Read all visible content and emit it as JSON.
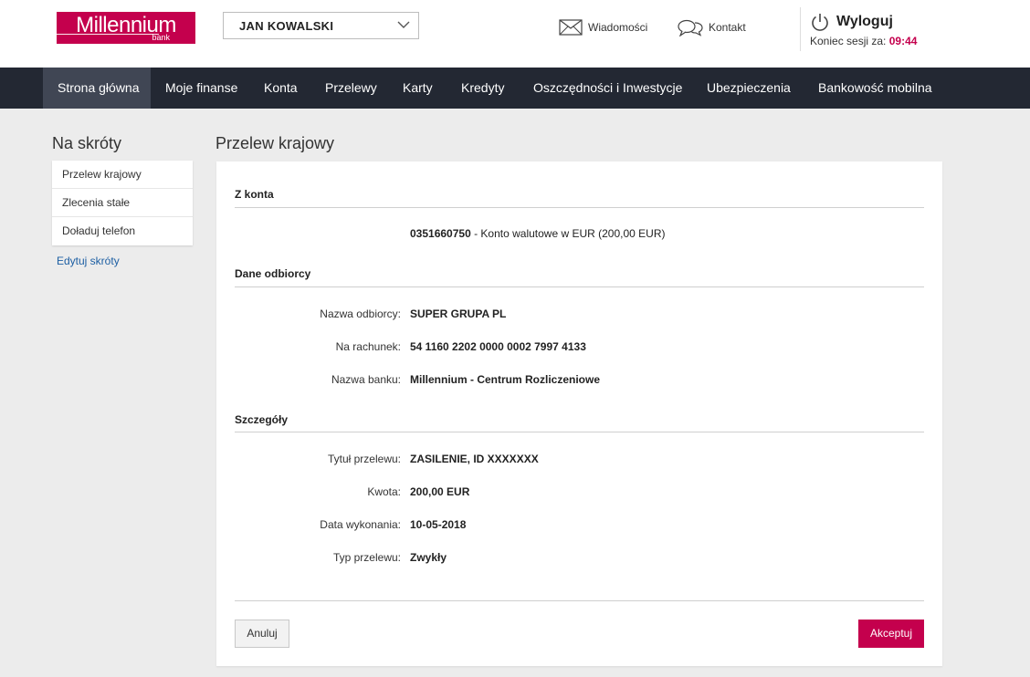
{
  "header": {
    "logo_brand": "Millennium",
    "logo_sub": "bank",
    "user_name": "JAN KOWALSKI",
    "messages_label": "Wiadomości",
    "contact_label": "Kontakt",
    "logout_label": "Wyloguj",
    "session_label": "Koniec sesji za:",
    "session_time": "09:44"
  },
  "nav": {
    "items": [
      {
        "label": "Strona główna",
        "active": true
      },
      {
        "label": "Moje finanse"
      },
      {
        "label": "Konta"
      },
      {
        "label": "Przelewy"
      },
      {
        "label": "Karty"
      },
      {
        "label": "Kredyty"
      },
      {
        "label": "Oszczędności i Inwestycje"
      },
      {
        "label": "Ubezpieczenia"
      },
      {
        "label": "Bankowość mobilna"
      }
    ]
  },
  "sidebar": {
    "title": "Na skróty",
    "items": [
      "Przelew krajowy",
      "Zlecenia stałe",
      "Doładuj telefon"
    ],
    "edit_label": "Edytuj skróty"
  },
  "main": {
    "title": "Przelew krajowy",
    "from_section": "Z konta",
    "from_account_number": "0351660750",
    "from_account_desc": " - Konto walutowe w EUR (200,00 EUR)",
    "recipient_section": "Dane odbiorcy",
    "recipient_rows": [
      {
        "label": "Nazwa odbiorcy:",
        "value": "SUPER GRUPA PL"
      },
      {
        "label": "Na rachunek:",
        "value": "54 1160 2202 0000 0002 7997 4133"
      },
      {
        "label": "Nazwa banku:",
        "value": "Millennium - Centrum Rozliczeniowe"
      }
    ],
    "details_section": "Szczegóły",
    "details_rows": [
      {
        "label": "Tytuł przelewu:",
        "value": "ZASILENIE, ID XXXXXXX"
      },
      {
        "label": "Kwota:",
        "value": "200,00 EUR"
      },
      {
        "label": "Data wykonania:",
        "value": "10-05-2018"
      },
      {
        "label": "Typ przelewu:",
        "value": "Zwykły"
      }
    ],
    "cancel_label": "Anuluj",
    "accept_label": "Akceptuj"
  },
  "colors": {
    "brand": "#c4004d",
    "nav_bg": "#232833",
    "nav_active": "#404654",
    "link": "#1d5fa3"
  }
}
